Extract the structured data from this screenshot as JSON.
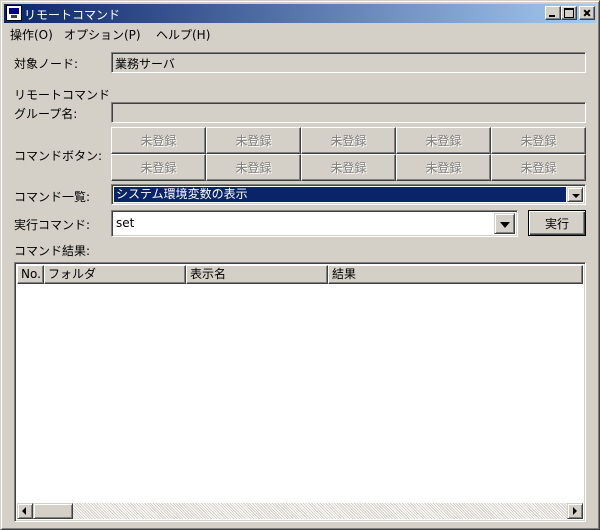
{
  "window": {
    "title": "リモートコマンド"
  },
  "menu": [
    "操作(O)",
    "オプション(P)",
    "ヘルプ(H)"
  ],
  "target_node": {
    "label": "対象ノード:",
    "value": "業務サーバ"
  },
  "group": {
    "label_line1": "リモートコマンド",
    "label_line2": "グループ名:",
    "value": ""
  },
  "command_buttons": {
    "label": "コマンドボタン:",
    "row1": [
      "未登録",
      "未登録",
      "未登録",
      "未登録",
      "未登録"
    ],
    "row2": [
      "未登録",
      "未登録",
      "未登録",
      "未登録",
      "未登録"
    ]
  },
  "command_list": {
    "label": "コマンド一覧:",
    "selected": "システム環境変数の表示"
  },
  "exec_command": {
    "label": "実行コマンド:",
    "value": "set",
    "run_label": "実行"
  },
  "results": {
    "label": "コマンド結果:",
    "columns": [
      "No.",
      "フォルダ",
      "表示名",
      "結果"
    ],
    "rows": []
  },
  "colors": {
    "selection": "#0a246a",
    "face": "#d4d0c8",
    "disabled_text": "#808080"
  }
}
